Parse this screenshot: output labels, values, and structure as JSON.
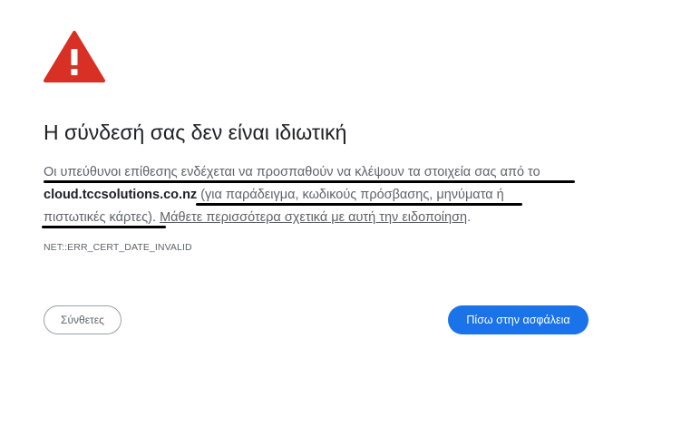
{
  "icons": {
    "warning": "warning-triangle-icon"
  },
  "colors": {
    "warning_red": "#d93025",
    "primary_blue": "#1a73e8",
    "text_primary": "#202124",
    "text_secondary": "#5f6368"
  },
  "heading": "Η σύνδεσή σας δεν είναι ιδιωτική",
  "message": {
    "line1": "Οι υπεύθυνοι επίθεσης ενδέχεται να προσπαθούν να κλέψουν τα στοιχεία σας από το",
    "domain": "cloud.tccsolutions.co.nz",
    "example_part1": " (για παράδειγμα, κωδικούς πρόσβασης, μηνύματα ή",
    "example_part2": "πιστωτικές κάρτες).",
    "learn_more": "Μάθετε περισσότερα σχετικά με αυτή την ειδοποίηση",
    "end_period": "."
  },
  "error_code": "NET::ERR_CERT_DATE_INVALID",
  "buttons": {
    "advanced": "Σύνθετες",
    "back_to_safety": "Πίσω στην ασφάλεια"
  }
}
